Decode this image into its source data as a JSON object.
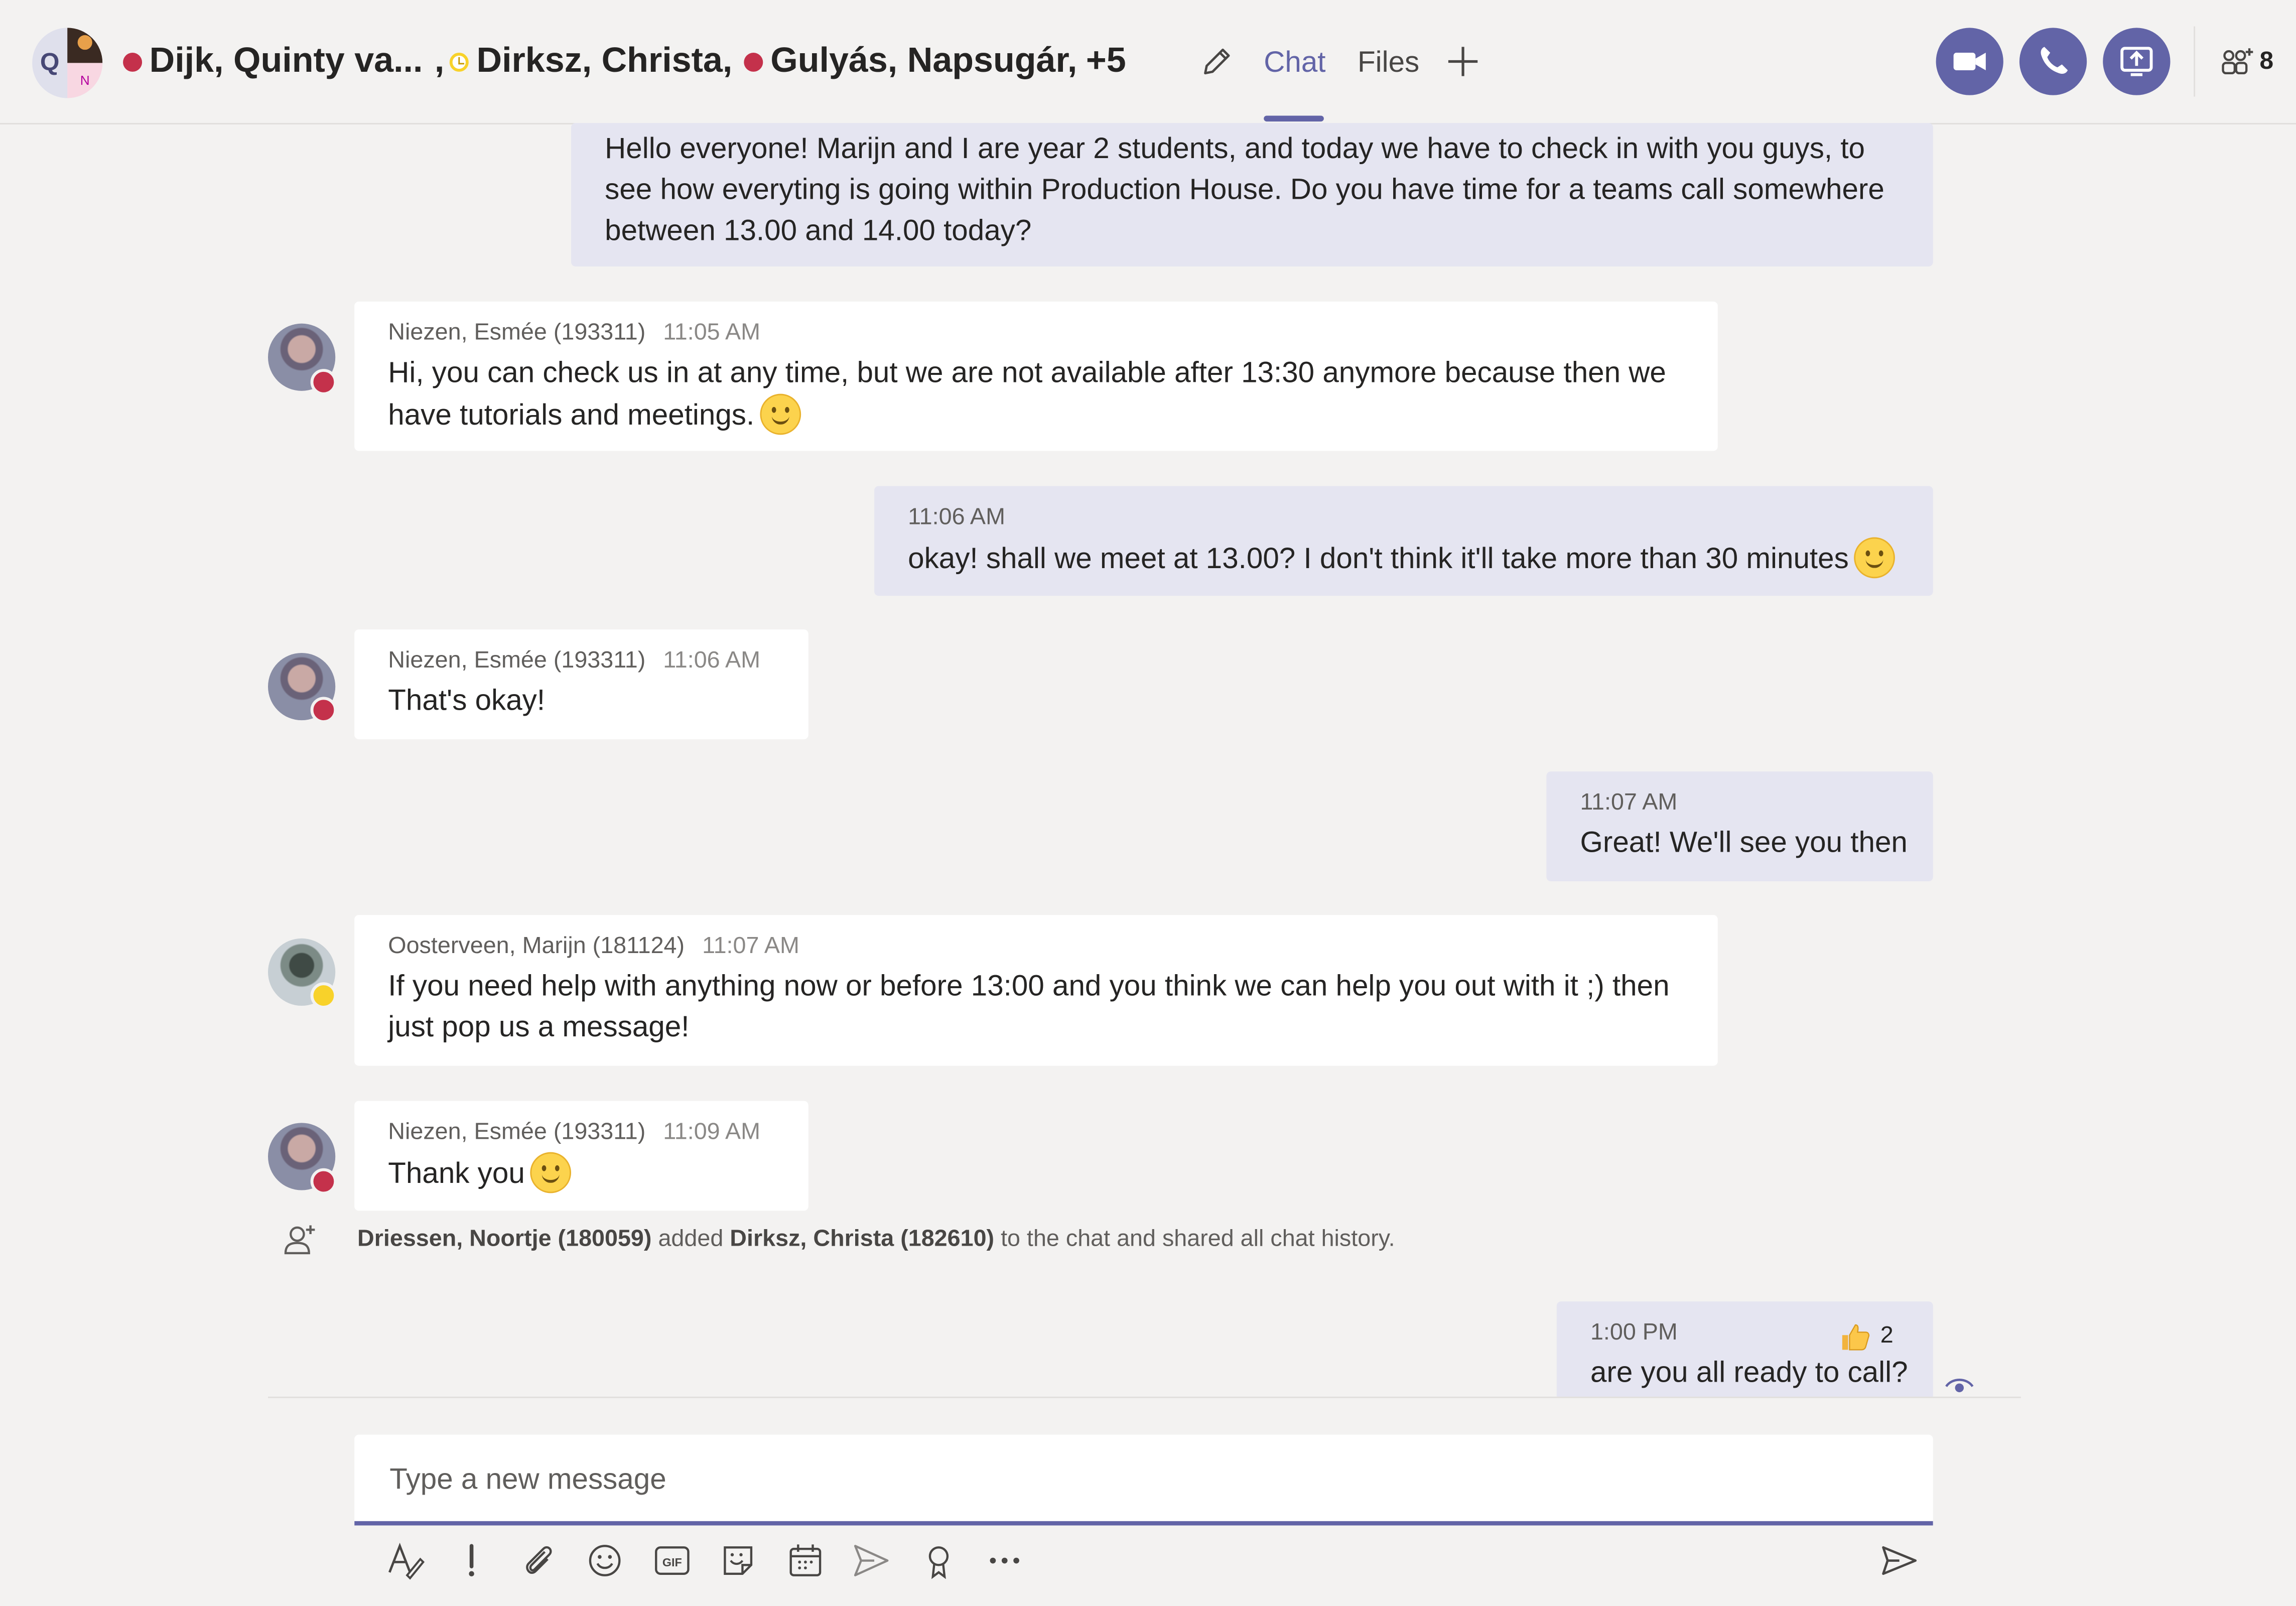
{
  "header": {
    "participants": [
      {
        "name": "Dijk, Quinty va...",
        "status": "busy"
      },
      {
        "name": "Dirksz, Christa,",
        "status": "away"
      },
      {
        "name": "Gulyás, Napsugár,",
        "status": "busy"
      }
    ],
    "separator": ",",
    "overflow": "+5",
    "avatar": {
      "initial_left": "Q",
      "initial_right": "N"
    },
    "tabs": [
      "Chat",
      "Files"
    ],
    "active_tab": "Chat",
    "people_count": "8",
    "accent": "#6264a7"
  },
  "messages": [
    {
      "direction": "outgoing",
      "text": "Hello everyone! Marijn and I are year 2 students, and today we have to check in with you guys, to see how everyting is going within Production House. Do you have time for a teams call somewhere between 13.00 and 14.00 today?"
    },
    {
      "direction": "incoming",
      "sender": "Niezen, Esmée (193311)",
      "time": "11:05 AM",
      "status": "busy",
      "text": "Hi, you can check us in at any time, but we are not available after 13:30 anymore because then we have tutorials and meetings."
    },
    {
      "direction": "outgoing",
      "time": "11:06 AM",
      "text": "okay! shall we meet at 13.00?  I don't think it'll take more than 30 minutes"
    },
    {
      "direction": "incoming",
      "sender": "Niezen, Esmée (193311)",
      "time": "11:06 AM",
      "status": "busy",
      "text": "That's okay!"
    },
    {
      "direction": "outgoing",
      "time": "11:07 AM",
      "text": "Great! We'll see you then"
    },
    {
      "direction": "incoming",
      "sender": "Oosterveen, Marijn (181124)",
      "time": "11:07 AM",
      "status": "away",
      "text": "If you need help with anything now or before 13:00 and you think we can help you out with it ;) then just pop us a message!"
    },
    {
      "direction": "incoming",
      "sender": "Niezen, Esmée (193311)",
      "time": "11:09 AM",
      "status": "busy",
      "text": "Thank you"
    },
    {
      "direction": "outgoing",
      "time": "1:00 PM",
      "text": "are you all ready to call?",
      "reaction": {
        "icon": "thumbs-up",
        "count": "2"
      }
    }
  ],
  "system_event": {
    "actor": "Driessen, Noortje (180059)",
    "verb": "added",
    "target": "Dirksz, Christa (182610)",
    "suffix": "to the chat and shared all chat history."
  },
  "compose": {
    "placeholder": "Type a new message",
    "toolbar": [
      "format-icon",
      "important-icon",
      "attach-icon",
      "emoji-icon",
      "gif-icon",
      "sticker-icon",
      "meeting-icon",
      "stream-icon",
      "praise-icon",
      "more-icon"
    ]
  }
}
